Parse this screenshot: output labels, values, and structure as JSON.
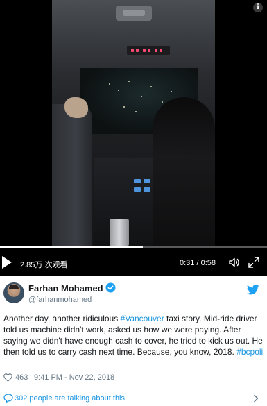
{
  "video": {
    "views": "2.85万 次观看",
    "time": "0:31 / 0:58",
    "progress_fraction": 0.534,
    "info_glyph": "i"
  },
  "author": {
    "name": "Farhan Mohamed",
    "handle": "@farhanmohamed"
  },
  "tweet": {
    "text_1": "Another day, another ridiculous ",
    "hashtag_1": "#Vancouver",
    "text_2": " taxi story. Mid-ride driver told us machine didn't work, asked us how we were paying. After saying we didn't have enough cash to cover, he tried to kick us out. He then told us to carry cash next time. Because, you know, 2018. ",
    "hashtag_2": "#bcpoli"
  },
  "meta": {
    "likes": "463",
    "timestamp": "9:41 PM - Nov 22, 2018"
  },
  "conversation": {
    "label": "302 people are talking about this"
  },
  "colors": {
    "link": "#1b95e0",
    "muted": "#657786",
    "text": "#14171a",
    "verified": "#1da1f2",
    "video_bg": "#000000"
  },
  "icons": [
    "play-icon",
    "volume-icon",
    "fullscreen-icon",
    "verified-icon",
    "twitter-icon",
    "heart-icon",
    "comment-icon",
    "chevron-right-icon",
    "info-icon"
  ]
}
